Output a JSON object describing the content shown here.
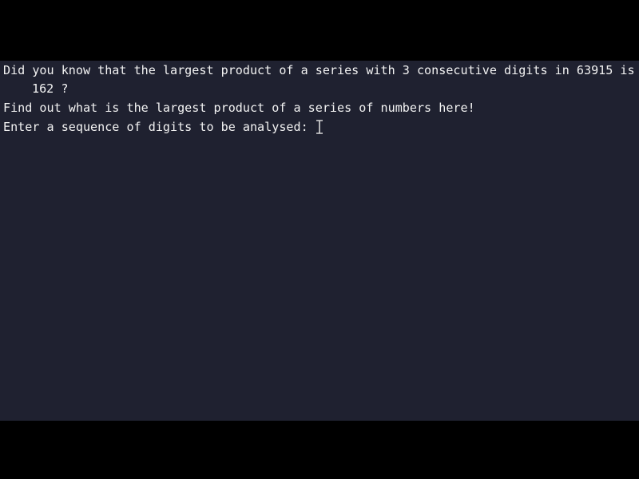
{
  "terminal": {
    "lines": {
      "fact_line_1": "Did you know that the largest product of a series with 3 consecutive digits in 63915 is",
      "fact_line_2": "162 ?",
      "intro": "Find out what is the largest product of a series of numbers here!",
      "prompt": "Enter a sequence of digits to be analysed: "
    },
    "input_value": "",
    "cursor_icon": "text-cursor-icon",
    "colors": {
      "background": "#1f2130",
      "text": "#f3f3f3",
      "letterbox": "#000000"
    }
  }
}
